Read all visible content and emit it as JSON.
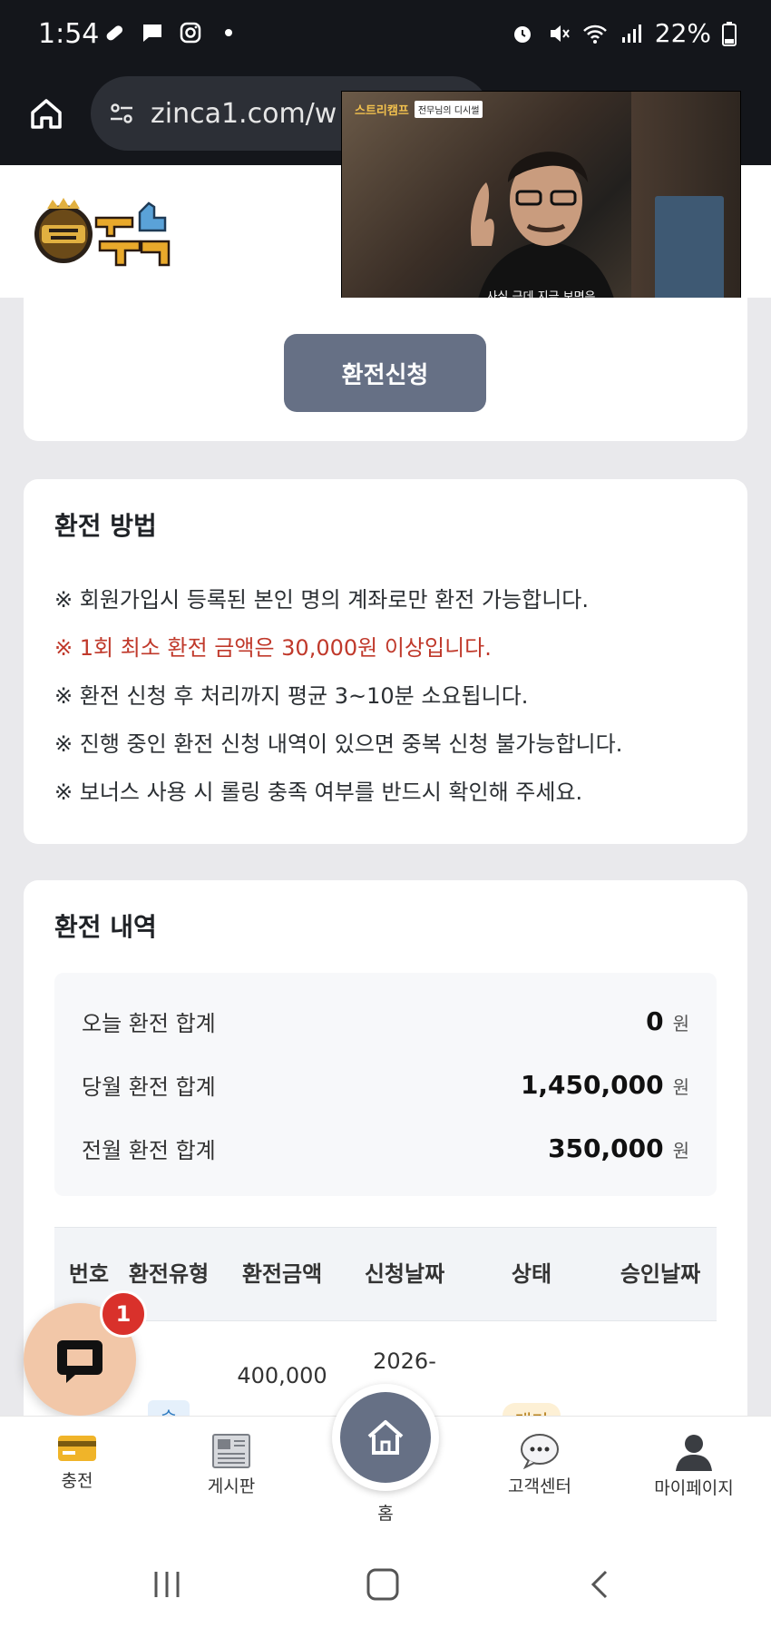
{
  "status_bar": {
    "time": "1:54",
    "battery": "22%"
  },
  "browser": {
    "url": "zinca1.com/w"
  },
  "video": {
    "channel": "스트리캠프",
    "episode_tag": "전무님의 디시썰",
    "caption": "사실 근데 지금 보면은"
  },
  "form": {
    "submit_label": "환전신청"
  },
  "method": {
    "title": "환전 방법",
    "rules": [
      "※ 회원가입시 등록된 본인 명의 계좌로만 환전 가능합니다.",
      "※ 1회 최소 환전 금액은 30,000원 이상입니다.",
      "※ 환전 신청 후 처리까지 평균 3~10분 소요됩니다.",
      "※ 진행 중인 환전 신청 내역이 있으면 중복 신청 불가능합니다.",
      "※ 보너스 사용 시 롤링 충족 여부를 반드시 확인해 주세요."
    ]
  },
  "history": {
    "title": "환전 내역",
    "summary": [
      {
        "label": "오늘 환전 합계",
        "value": "0",
        "unit": "원"
      },
      {
        "label": "당월 환전 합계",
        "value": "1,450,000",
        "unit": "원"
      },
      {
        "label": "전월 환전 합계",
        "value": "350,000",
        "unit": "원"
      }
    ],
    "columns": [
      "번호",
      "환전유형",
      "환전금액",
      "신청날짜",
      "상태",
      "승인날짜"
    ],
    "rows": [
      {
        "no": "...",
        "type": "슬",
        "amount": "400,000",
        "date": "2026-",
        "status": "대기",
        "approved": ""
      }
    ]
  },
  "chat": {
    "badge": "1"
  },
  "nav": {
    "items": [
      "충전",
      "게시판",
      "홈",
      "고객센터",
      "마이페이지"
    ]
  }
}
